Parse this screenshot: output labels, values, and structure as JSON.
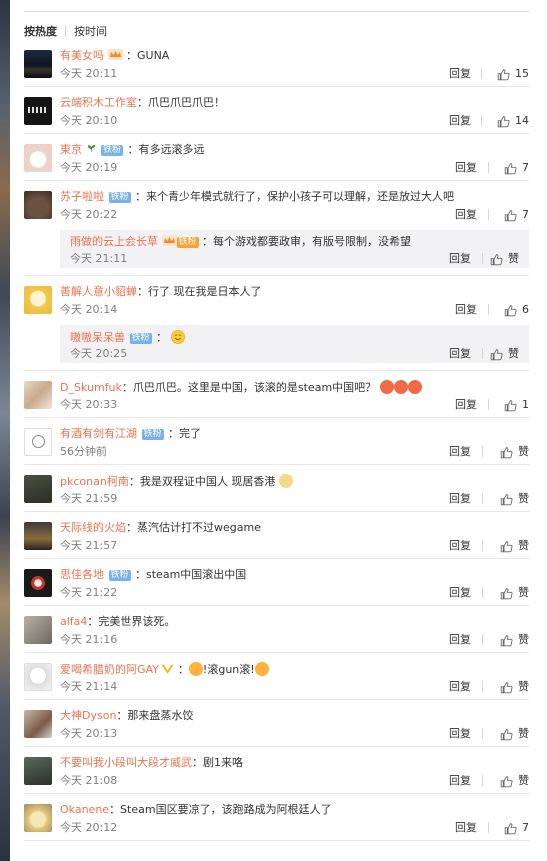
{
  "sort_bar": {
    "hot": "按热度",
    "time": "按时间"
  },
  "labels": {
    "reply": "回复",
    "like_zero": "赞"
  },
  "comments": [
    {
      "user": "有美女吗",
      "text": "：GUNA",
      "time": "今天 20:11",
      "likes": "15"
    },
    {
      "user": "云端积木工作室",
      "text": "：爪巴爪巴爪巴！",
      "time": "今天 20:10",
      "likes": "14"
    },
    {
      "user": "東京",
      "fan_badge": "铁粉",
      "text": "：有多远滚多远",
      "time": "今天 20:19",
      "likes": "7"
    },
    {
      "user": "苏子啦啦",
      "fan_badge": "铁粉",
      "text": "：来个青少年模式就行了，保护小孩子可以理解，还是放过大人吧",
      "time": "今天 20:22",
      "likes": "7",
      "reply": {
        "user": "雨做的云上会长草",
        "gold_badge": "铁粉",
        "text": "：每个游戏都要政审，有版号限制，没希望",
        "time": "今天 21:11",
        "likes": "赞"
      }
    },
    {
      "user": "善解人意小貂蝉",
      "text": "：行了 现在我是日本人了",
      "time": "今天 20:14",
      "likes": "6",
      "reply": {
        "user": "嗷嗷呆呆兽",
        "fan_badge": "铁粉",
        "text": "：",
        "time": "今天 20:25",
        "likes": "赞"
      }
    },
    {
      "user": "D_Skumfuk",
      "text": "：爪巴爪巴。这里是中国，该滚的是steam中国吧？",
      "time": "今天 20:33",
      "likes": "1"
    },
    {
      "user": "有酒有剑有江湖",
      "fan_badge": "铁粉",
      "text": "：完了",
      "time": "56分钟前",
      "likes": "赞"
    },
    {
      "user": "pkconan柯南",
      "text": "：我是双程证中国人 现居香港",
      "time": "今天 21:59",
      "likes": "赞"
    },
    {
      "user": "天际线的火焰",
      "text": "：蒸汽估计打不过wegame",
      "time": "今天 21:57",
      "likes": "赞"
    },
    {
      "user": "思佳各地",
      "fan_badge": "铁粉",
      "text": "：steam中国滚出中国",
      "time": "今天 21:22",
      "likes": "赞"
    },
    {
      "user": "alfa4",
      "text": "：完美世界该死。",
      "time": "今天 21:16",
      "likes": "赞"
    },
    {
      "user": "爱喝希腊奶的阿GAY",
      "text": "：",
      "text2": "!滚gun滚!",
      "time": "今天 21:14",
      "likes": "赞"
    },
    {
      "user": "大神Dyson",
      "text": "：那来盘蒸水饺",
      "time": "今天 20:13",
      "likes": "赞"
    },
    {
      "user": "不要叫我小段叫大段才威武",
      "text": "：剧1来咯",
      "time": "今天 21:08",
      "likes": "赞"
    },
    {
      "user": "Okanene",
      "text": "：Steam国区要凉了，该跑路成为阿根廷人了",
      "time": "今天 20:12",
      "likes": "7"
    }
  ],
  "colors": {
    "username": "#eb7350",
    "time": "#808080",
    "fan_badge": "#7ab1e8",
    "reply_bg": "#f2f2f5"
  },
  "icons": {
    "like": "thumbs-up-icon",
    "emoji": "smile-emoji-icon",
    "vip": "vip-crown-icon"
  }
}
